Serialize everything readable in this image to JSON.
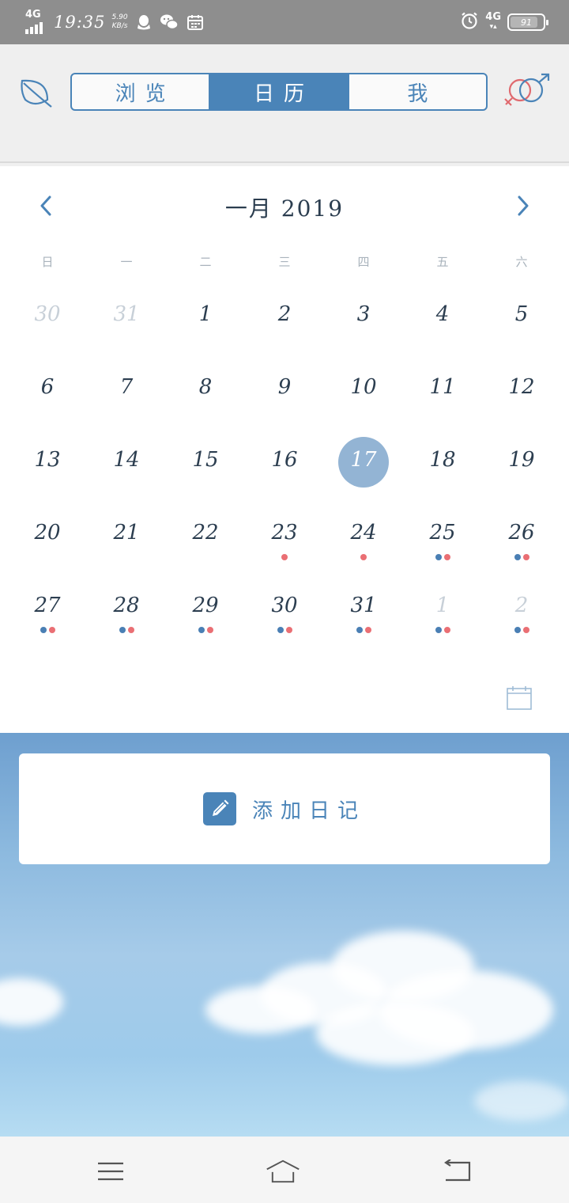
{
  "status_bar": {
    "network_left": "4G",
    "time": "19:35",
    "speed_value": "5.90",
    "speed_unit": "KB/s",
    "network_right": "4G",
    "battery": "91",
    "icons": [
      "qq-icon",
      "wechat-icon",
      "calendar-icon",
      "alarm-icon"
    ]
  },
  "header": {
    "tabs": [
      {
        "label": "浏览",
        "active": false
      },
      {
        "label": "日历",
        "active": true
      },
      {
        "label": "我",
        "active": false
      }
    ]
  },
  "calendar": {
    "title": "一月 2019",
    "weekdays": [
      "日",
      "一",
      "二",
      "三",
      "四",
      "五",
      "六"
    ],
    "weeks": [
      [
        {
          "d": "30",
          "m": 1
        },
        {
          "d": "31",
          "m": 1
        },
        {
          "d": "1"
        },
        {
          "d": "2"
        },
        {
          "d": "3"
        },
        {
          "d": "4"
        },
        {
          "d": "5"
        }
      ],
      [
        {
          "d": "6"
        },
        {
          "d": "7"
        },
        {
          "d": "8"
        },
        {
          "d": "9"
        },
        {
          "d": "10"
        },
        {
          "d": "11"
        },
        {
          "d": "12"
        }
      ],
      [
        {
          "d": "13"
        },
        {
          "d": "14"
        },
        {
          "d": "15"
        },
        {
          "d": "16"
        },
        {
          "d": "17",
          "selected": true
        },
        {
          "d": "18"
        },
        {
          "d": "19"
        }
      ],
      [
        {
          "d": "20"
        },
        {
          "d": "21"
        },
        {
          "d": "22"
        },
        {
          "d": "23",
          "dots": [
            "red"
          ]
        },
        {
          "d": "24",
          "dots": [
            "red"
          ]
        },
        {
          "d": "25",
          "dots": [
            "blue",
            "red"
          ]
        },
        {
          "d": "26",
          "dots": [
            "blue",
            "red"
          ]
        }
      ],
      [
        {
          "d": "27",
          "dots": [
            "blue",
            "red"
          ]
        },
        {
          "d": "28",
          "dots": [
            "blue",
            "red"
          ]
        },
        {
          "d": "29",
          "dots": [
            "blue",
            "red"
          ]
        },
        {
          "d": "30",
          "dots": [
            "blue",
            "red"
          ]
        },
        {
          "d": "31",
          "dots": [
            "blue",
            "red"
          ]
        },
        {
          "d": "1",
          "m": 1,
          "dots": [
            "blue",
            "red"
          ]
        },
        {
          "d": "2",
          "m": 1,
          "dots": [
            "blue",
            "red"
          ]
        }
      ]
    ]
  },
  "add_diary": {
    "label": "添加日记"
  },
  "colors": {
    "accent": "#4a84b8",
    "selected_day": "#93b4d4",
    "dot_blue": "#4a7fb4",
    "dot_red": "#ea6f74",
    "status_bar": "#8e8e8e"
  }
}
